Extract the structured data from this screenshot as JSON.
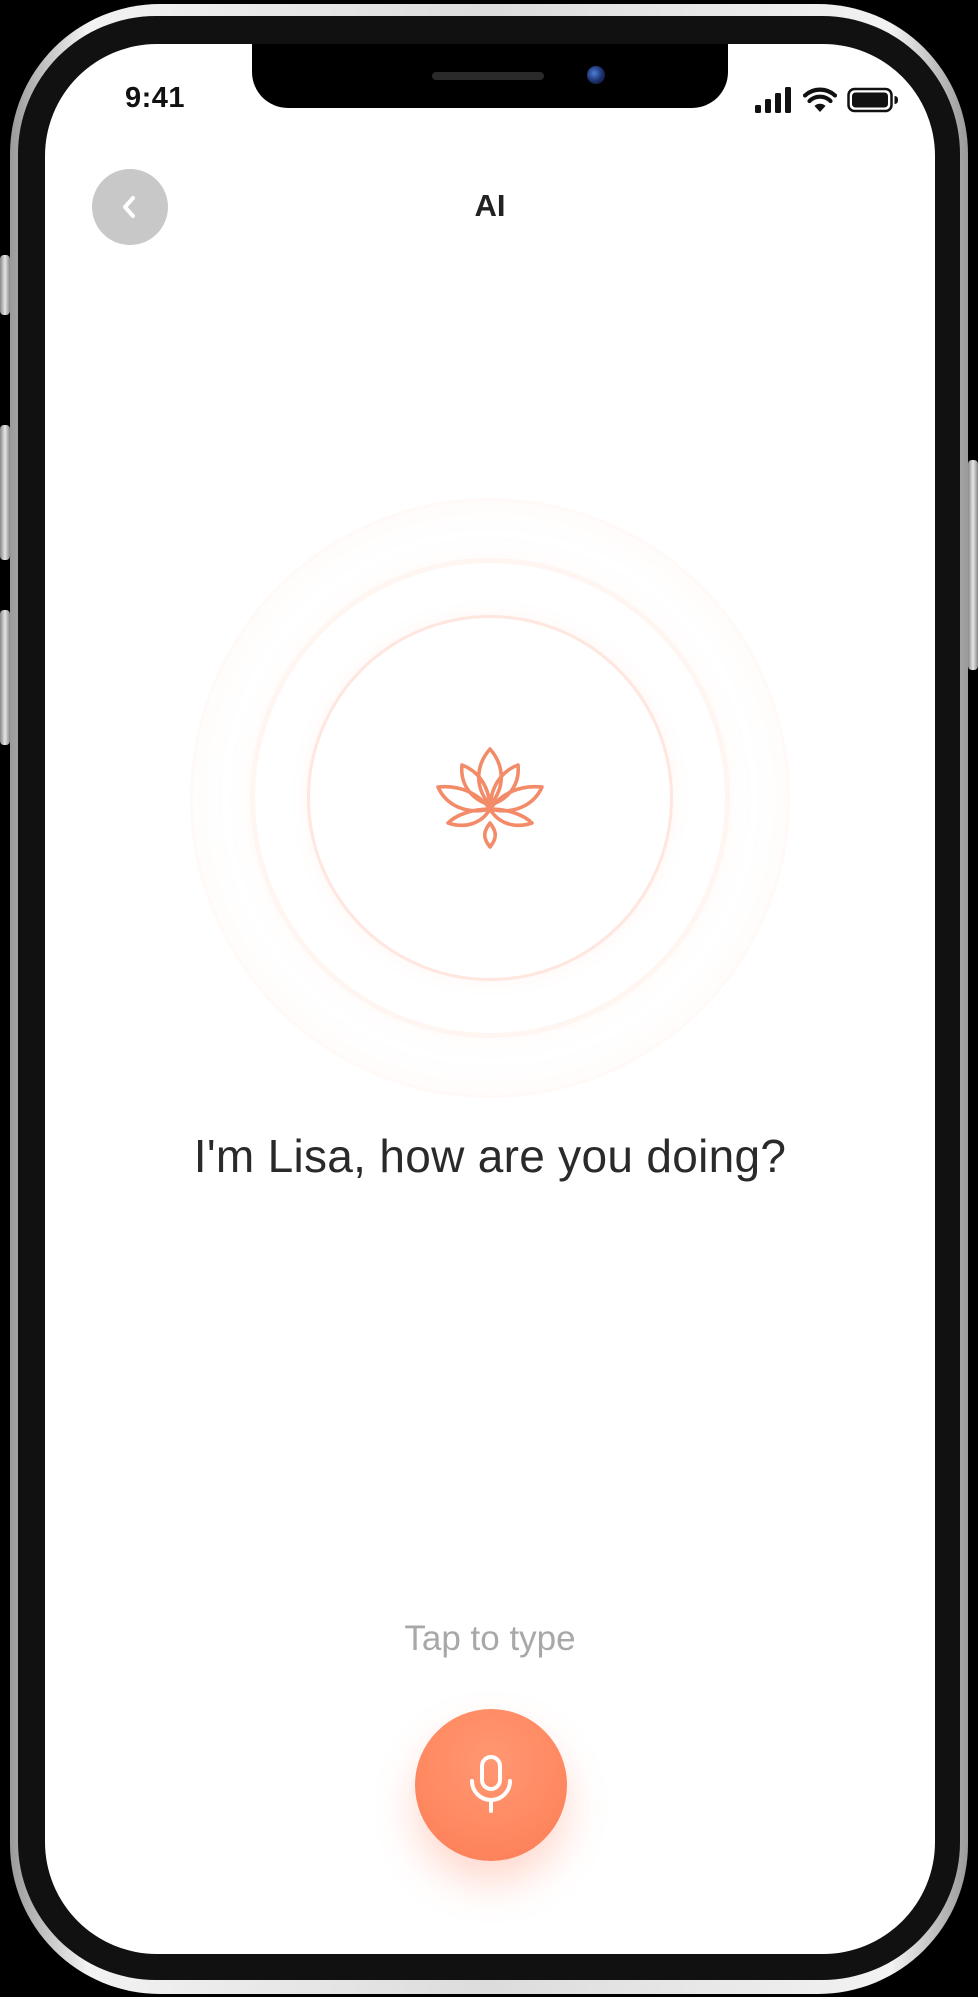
{
  "status_bar": {
    "time": "9:41",
    "icons": [
      "signal-icon",
      "wifi-icon",
      "battery-icon"
    ]
  },
  "header": {
    "title": "AI",
    "back_icon": "chevron-left-icon"
  },
  "assistant": {
    "icon": "lotus-icon",
    "greeting": "I'm Lisa, how are you doing?"
  },
  "input": {
    "hint": "Tap to type",
    "mic_icon": "microphone-icon"
  },
  "colors": {
    "accent": "#ff8a62",
    "accent_dark": "#fa7b54",
    "back_button_bg": "#c8c8c8",
    "text_primary": "#2a2a2a",
    "text_hint": "#a8a8a8"
  }
}
